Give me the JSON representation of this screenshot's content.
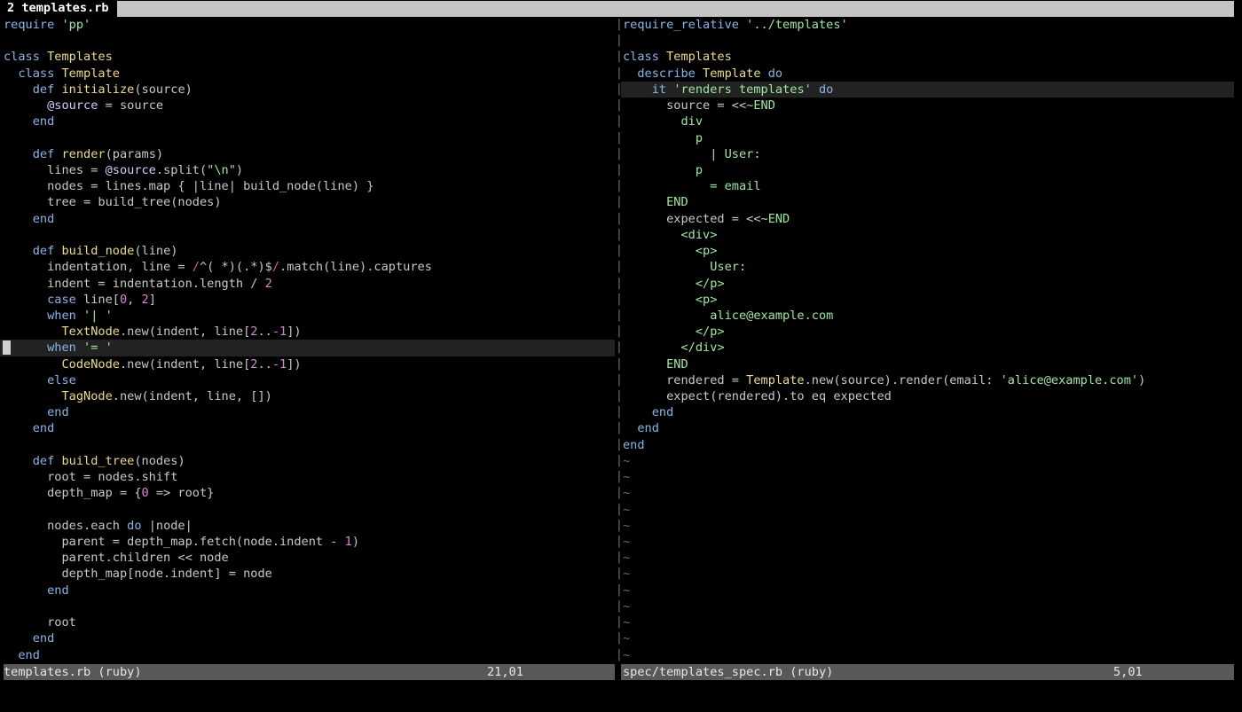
{
  "tab": {
    "number": "2",
    "name": "templates.rb"
  },
  "left": {
    "status_name": "templates.rb (ruby)",
    "status_pos": "21,01",
    "cursor_line": 20,
    "lines": [
      [
        [
          "kw",
          "require "
        ],
        [
          "str",
          "'pp'"
        ]
      ],
      [],
      [
        [
          "kw",
          "class "
        ],
        [
          "cls",
          "Templates"
        ]
      ],
      [
        [
          "",
          "  "
        ],
        [
          "kw",
          "class "
        ],
        [
          "cls",
          "Template"
        ]
      ],
      [
        [
          "",
          "    "
        ],
        [
          "kw",
          "def "
        ],
        [
          "fn",
          "initialize"
        ],
        [
          "",
          "(source)"
        ]
      ],
      [
        [
          "",
          "      "
        ],
        [
          "iv",
          "@source"
        ],
        [
          "",
          " = source"
        ]
      ],
      [
        [
          "",
          "    "
        ],
        [
          "kw",
          "end"
        ]
      ],
      [],
      [
        [
          "",
          "    "
        ],
        [
          "kw",
          "def "
        ],
        [
          "fn",
          "render"
        ],
        [
          "",
          "(params)"
        ]
      ],
      [
        [
          "",
          "      lines = "
        ],
        [
          "iv",
          "@source"
        ],
        [
          "",
          ".split("
        ],
        [
          "str",
          "\"\\n\""
        ],
        [
          "",
          ")"
        ]
      ],
      [
        [
          "",
          "      nodes = lines.map { |line| build_node(line) }"
        ]
      ],
      [
        [
          "",
          "      tree = build_tree(nodes)"
        ]
      ],
      [
        [
          "",
          "    "
        ],
        [
          "kw",
          "end"
        ]
      ],
      [],
      [
        [
          "",
          "    "
        ],
        [
          "kw",
          "def "
        ],
        [
          "fn",
          "build_node"
        ],
        [
          "",
          "(line)"
        ]
      ],
      [
        [
          "",
          "      indentation, line = "
        ],
        [
          "rx",
          "/"
        ],
        [
          "",
          "^( *)(.*)$"
        ],
        [
          "rx",
          "/"
        ],
        [
          "",
          ".match(line).captures"
        ]
      ],
      [
        [
          "",
          "      indent = indentation.length / "
        ],
        [
          "num",
          "2"
        ]
      ],
      [
        [
          "",
          "      "
        ],
        [
          "kw",
          "case "
        ],
        [
          "",
          "line["
        ],
        [
          "num",
          "0"
        ],
        [
          "",
          ", "
        ],
        [
          "num",
          "2"
        ],
        [
          "",
          "]"
        ]
      ],
      [
        [
          "",
          "      "
        ],
        [
          "kw",
          "when "
        ],
        [
          "str",
          "'| '"
        ]
      ],
      [
        [
          "",
          "        "
        ],
        [
          "cls",
          "TextNode"
        ],
        [
          "",
          ".new(indent, line["
        ],
        [
          "num",
          "2"
        ],
        [
          "",
          ".."
        ],
        [
          "num",
          "-1"
        ],
        [
          "",
          "])"
        ]
      ],
      [
        [
          "",
          "      "
        ],
        [
          "kw",
          "when "
        ],
        [
          "str",
          "'= '"
        ]
      ],
      [
        [
          "",
          "        "
        ],
        [
          "cls",
          "CodeNode"
        ],
        [
          "",
          ".new(indent, line["
        ],
        [
          "num",
          "2"
        ],
        [
          "",
          ".."
        ],
        [
          "num",
          "-1"
        ],
        [
          "",
          "])"
        ]
      ],
      [
        [
          "",
          "      "
        ],
        [
          "kw",
          "else"
        ]
      ],
      [
        [
          "",
          "        "
        ],
        [
          "cls",
          "TagNode"
        ],
        [
          "",
          ".new(indent, line, [])"
        ]
      ],
      [
        [
          "",
          "      "
        ],
        [
          "kw",
          "end"
        ]
      ],
      [
        [
          "",
          "    "
        ],
        [
          "kw",
          "end"
        ]
      ],
      [],
      [
        [
          "",
          "    "
        ],
        [
          "kw",
          "def "
        ],
        [
          "fn",
          "build_tree"
        ],
        [
          "",
          "(nodes)"
        ]
      ],
      [
        [
          "",
          "      root = nodes.shift"
        ]
      ],
      [
        [
          "",
          "      depth_map = {"
        ],
        [
          "num",
          "0"
        ],
        [
          "",
          " => root}"
        ]
      ],
      [],
      [
        [
          "",
          "      nodes.each "
        ],
        [
          "kw",
          "do"
        ],
        [
          "",
          " |node|"
        ]
      ],
      [
        [
          "",
          "        parent = depth_map.fetch(node.indent - "
        ],
        [
          "num",
          "1"
        ],
        [
          "",
          ")"
        ]
      ],
      [
        [
          "",
          "        parent.children << node"
        ]
      ],
      [
        [
          "",
          "        depth_map[node.indent] = node"
        ]
      ],
      [
        [
          "",
          "      "
        ],
        [
          "kw",
          "end"
        ]
      ],
      [],
      [
        [
          "",
          "      root"
        ]
      ],
      [
        [
          "",
          "    "
        ],
        [
          "kw",
          "end"
        ]
      ],
      [
        [
          "",
          "  "
        ],
        [
          "kw",
          "end"
        ]
      ]
    ]
  },
  "right": {
    "status_name": "spec/templates_spec.rb (ruby)",
    "status_pos": "5,01",
    "cursor_line": 4,
    "lines": [
      [
        [
          "kw",
          "require_relative "
        ],
        [
          "str",
          "'../templates'"
        ]
      ],
      [],
      [
        [
          "kw",
          "class "
        ],
        [
          "cls",
          "Templates"
        ]
      ],
      [
        [
          "",
          "  "
        ],
        [
          "kw",
          "describe "
        ],
        [
          "cls",
          "Template"
        ],
        [
          "",
          " "
        ],
        [
          "kw",
          "do"
        ]
      ],
      [
        [
          "",
          "    "
        ],
        [
          "kw",
          "it "
        ],
        [
          "str",
          "'renders templates'"
        ],
        [
          "",
          " "
        ],
        [
          "kw",
          "do"
        ]
      ],
      [
        [
          "",
          "      source = <<~"
        ],
        [
          "str",
          "END"
        ]
      ],
      [
        [
          "str",
          "        div"
        ]
      ],
      [
        [
          "str",
          "          p"
        ]
      ],
      [
        [
          "str",
          "            | User:"
        ]
      ],
      [
        [
          "str",
          "          p"
        ]
      ],
      [
        [
          "str",
          "            = email"
        ]
      ],
      [
        [
          "str",
          "      END"
        ]
      ],
      [
        [
          "",
          "      expected = <<~"
        ],
        [
          "str",
          "END"
        ]
      ],
      [
        [
          "str",
          "        <div>"
        ]
      ],
      [
        [
          "str",
          "          <p>"
        ]
      ],
      [
        [
          "str",
          "            User:"
        ]
      ],
      [
        [
          "str",
          "          </p>"
        ]
      ],
      [
        [
          "str",
          "          <p>"
        ]
      ],
      [
        [
          "str",
          "            alice@example.com"
        ]
      ],
      [
        [
          "str",
          "          </p>"
        ]
      ],
      [
        [
          "str",
          "        </div>"
        ]
      ],
      [
        [
          "str",
          "      END"
        ]
      ],
      [
        [
          "",
          "      rendered = "
        ],
        [
          "cls",
          "Template"
        ],
        [
          "",
          ".new(source).render(email: "
        ],
        [
          "str",
          "'alice@example.com'"
        ],
        [
          "",
          ")"
        ]
      ],
      [
        [
          "",
          "      expect(rendered).to eq expected"
        ]
      ],
      [
        [
          "",
          "    "
        ],
        [
          "kw",
          "end"
        ]
      ],
      [
        [
          "",
          "  "
        ],
        [
          "kw",
          "end"
        ]
      ],
      [
        [
          "kw",
          "end"
        ]
      ],
      [
        [
          "tilde",
          "~"
        ]
      ],
      [
        [
          "tilde",
          "~"
        ]
      ],
      [
        [
          "tilde",
          "~"
        ]
      ],
      [
        [
          "tilde",
          "~"
        ]
      ],
      [
        [
          "tilde",
          "~"
        ]
      ],
      [
        [
          "tilde",
          "~"
        ]
      ],
      [
        [
          "tilde",
          "~"
        ]
      ],
      [
        [
          "tilde",
          "~"
        ]
      ],
      [
        [
          "tilde",
          "~"
        ]
      ],
      [
        [
          "tilde",
          "~"
        ]
      ],
      [
        [
          "tilde",
          "~"
        ]
      ],
      [
        [
          "tilde",
          "~"
        ]
      ],
      [
        [
          "tilde",
          "~"
        ]
      ]
    ]
  }
}
